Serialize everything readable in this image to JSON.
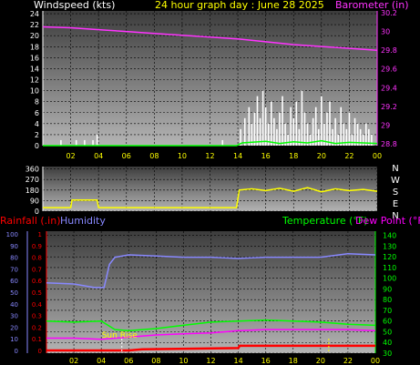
{
  "chart_data": [
    {
      "id": "wind_baro",
      "type": "bar+line",
      "title": "24 hour graph day : June 28 2025",
      "left_axis_label": "Windspeed (kts)",
      "right_axis_label": "Barometer (in)",
      "x_ticks": [
        "02",
        "04",
        "06",
        "08",
        "10",
        "12",
        "14",
        "16",
        "18",
        "20",
        "22",
        "00"
      ],
      "left_ticks": [
        0,
        2,
        4,
        6,
        8,
        10,
        12,
        14,
        16,
        18,
        20,
        22,
        24
      ],
      "left_ylim": [
        0,
        24.5
      ],
      "right_ticks": [
        "28.8",
        "29",
        "29.2",
        "29.4",
        "29.6",
        "29.8",
        "30",
        "30.2"
      ],
      "right_ylim": [
        28.78,
        30.22
      ],
      "colors": {
        "left": "#ffffff",
        "right": "#ff33ff",
        "title": "#ffff00",
        "wind_bars": "#ffffff",
        "gust_line": "#00ff00"
      },
      "barometer": {
        "x": [
          0,
          2,
          4,
          6,
          8,
          10,
          12,
          14,
          16,
          18,
          20,
          22,
          24
        ],
        "values": [
          30.05,
          30.04,
          30.02,
          30.0,
          29.98,
          29.96,
          29.94,
          29.92,
          29.89,
          29.86,
          29.84,
          29.82,
          29.8
        ]
      },
      "wind_bars": {
        "x": [
          1.3,
          2.4,
          3.0,
          3.6,
          3.9,
          12.9,
          14.2,
          14.5,
          14.8,
          15.0,
          15.2,
          15.4,
          15.6,
          15.8,
          16.0,
          16.2,
          16.4,
          16.6,
          16.8,
          17.0,
          17.2,
          17.4,
          17.6,
          17.8,
          18.0,
          18.2,
          18.4,
          18.6,
          18.8,
          19.0,
          19.2,
          19.4,
          19.6,
          19.8,
          20.0,
          20.2,
          20.4,
          20.6,
          20.8,
          21.0,
          21.2,
          21.4,
          21.6,
          21.8,
          22.0,
          22.2,
          22.4,
          22.6,
          22.8,
          23.0,
          23.2,
          23.4,
          23.6
        ],
        "values": [
          1,
          1,
          1,
          1,
          2,
          1,
          3,
          5,
          7,
          4,
          6,
          9,
          5,
          10,
          7,
          4,
          8,
          5,
          3,
          6,
          9,
          4,
          2,
          7,
          5,
          8,
          3,
          10,
          6,
          4,
          2,
          5,
          7,
          3,
          9,
          4,
          6,
          8,
          3,
          5,
          2,
          7,
          4,
          3,
          6,
          2,
          5,
          4,
          3,
          2,
          4,
          3,
          2
        ]
      },
      "gust_line": {
        "x": [
          0,
          13.9,
          14.3,
          16,
          17,
          18,
          19,
          20,
          21,
          22,
          23,
          24
        ],
        "values": [
          0,
          0,
          0.5,
          0.8,
          0.4,
          0.7,
          0.5,
          0.9,
          0.4,
          0.6,
          0.5,
          0.4
        ]
      }
    },
    {
      "id": "wind_dir",
      "type": "line",
      "left_ticks": [
        0,
        90,
        180,
        270,
        360
      ],
      "left_ylim": [
        0,
        380
      ],
      "right_letters": [
        "N",
        "W",
        "S",
        "E",
        "N"
      ],
      "x_ticks": [
        "02",
        "04",
        "06",
        "08",
        "10",
        "12",
        "14",
        "16",
        "18",
        "20",
        "22",
        "00"
      ],
      "colors": {
        "line": "#ffff00",
        "axis": "#ffffff"
      },
      "direction": {
        "x": [
          0,
          2.0,
          2.1,
          3.9,
          4.0,
          13.9,
          14.1,
          15,
          16,
          17,
          18,
          19,
          20,
          21,
          22,
          23,
          24
        ],
        "values": [
          30,
          30,
          95,
          95,
          30,
          30,
          180,
          190,
          175,
          195,
          170,
          200,
          165,
          190,
          175,
          185,
          170
        ]
      }
    },
    {
      "id": "temp_hum",
      "type": "line",
      "labels": {
        "rain": "Rainfall (.in)",
        "humidity": "Humidity",
        "temperature": "Temperature (°F)",
        "dew_point": "Dew Point (°F)"
      },
      "sunrise_label": "Sun Rise",
      "humidity_ticks": [
        0,
        10,
        20,
        30,
        40,
        50,
        60,
        70,
        80,
        90,
        100
      ],
      "rain_ticks": [
        "0",
        "0.1",
        "0.2",
        "0.3",
        "0.4",
        "0.5",
        "0.6",
        "0.7",
        "0.8",
        "0.9",
        "1"
      ],
      "temp_ticks": [
        30,
        40,
        50,
        60,
        70,
        80,
        90,
        100,
        110,
        120,
        130,
        140
      ],
      "temp_ylim": [
        30,
        144
      ],
      "x_ticks": [
        "02",
        "04",
        "06",
        "08",
        "10",
        "12",
        "14",
        "16",
        "18",
        "20",
        "22",
        "00"
      ],
      "colors": {
        "rain": "#ff0000",
        "humidity": "#8888ff",
        "temperature": "#00ff00",
        "dew_point": "#ff00ff",
        "temp_axis": "#00ff00",
        "hum_axis": "#8888ff",
        "sunrise": "#ffff00",
        "sun_marker": "#ffffff"
      },
      "humidity": {
        "x": [
          0,
          2.0,
          3.5,
          4.2,
          4.6,
          5.0,
          6.0,
          8,
          10,
          12,
          14,
          16,
          18,
          20,
          22,
          24
        ],
        "values": [
          58,
          57,
          54,
          54,
          74,
          80,
          82,
          81,
          80,
          80,
          79,
          80,
          80,
          80,
          83,
          82
        ]
      },
      "temperature": {
        "x": [
          0,
          2,
          4,
          5,
          6,
          8,
          10,
          12,
          14,
          16,
          18,
          20,
          22,
          24
        ],
        "values": [
          60,
          59,
          60,
          52,
          51,
          53,
          56,
          59,
          60,
          61,
          60,
          59,
          57,
          56
        ]
      },
      "dew_point": {
        "x": [
          0,
          2,
          4,
          5,
          6,
          8,
          10,
          12,
          14,
          16,
          18,
          20,
          22,
          24
        ],
        "values": [
          44,
          44,
          43,
          44,
          45,
          47,
          48,
          49,
          51,
          52,
          52,
          52,
          52,
          51
        ]
      },
      "rain": {
        "x": [
          0,
          6,
          7,
          14,
          14.1,
          24
        ],
        "values": [
          0,
          0,
          0.01,
          0.02,
          0.04,
          0.04
        ]
      },
      "sunrise_hour": 5.5
    }
  ]
}
